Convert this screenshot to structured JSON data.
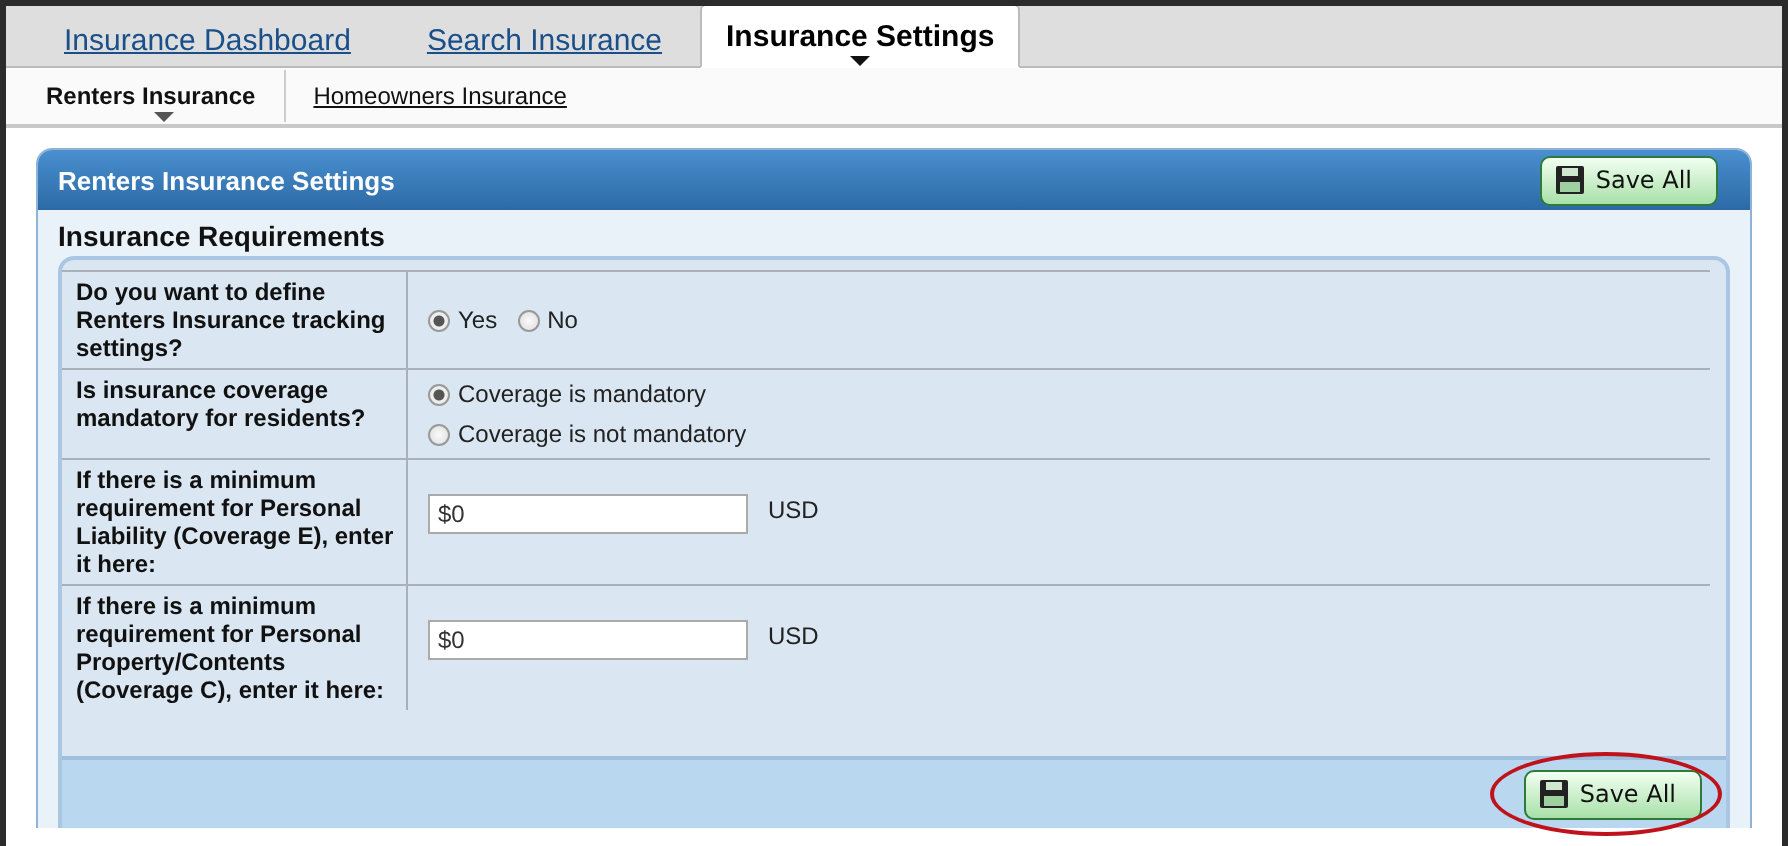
{
  "tabs": [
    {
      "label": "Insurance Dashboard",
      "selected": false
    },
    {
      "label": "Search Insurance",
      "selected": false
    },
    {
      "label": "Insurance Settings",
      "selected": true
    }
  ],
  "subtabs": [
    {
      "label": "Renters Insurance",
      "selected": true
    },
    {
      "label": "Homeowners Insurance",
      "selected": false
    }
  ],
  "panel": {
    "title": "Renters Insurance Settings",
    "save_button": "Save All",
    "section_title": "Insurance Requirements",
    "rows": [
      {
        "kind": "radio-inline",
        "question": "Do you want to define Renters Insurance tracking settings?",
        "options": [
          {
            "label": "Yes",
            "selected": true
          },
          {
            "label": "No",
            "selected": false
          }
        ]
      },
      {
        "kind": "radio-stack",
        "question": "Is insurance coverage mandatory for residents?",
        "options": [
          {
            "label": "Coverage is mandatory",
            "selected": true
          },
          {
            "label": "Coverage is not mandatory",
            "selected": false
          }
        ]
      },
      {
        "kind": "amount",
        "question": "If there is a minimum requirement for Personal Liability (Coverage E), enter it here:",
        "value": "$0",
        "unit": "USD"
      },
      {
        "kind": "amount",
        "question": "If there is a minimum requirement for Personal Property/Contents (Coverage C), enter it here:",
        "value": "$0",
        "unit": "USD"
      }
    ],
    "footer_button": {
      "label": "Save All",
      "highlighted": true
    }
  }
}
